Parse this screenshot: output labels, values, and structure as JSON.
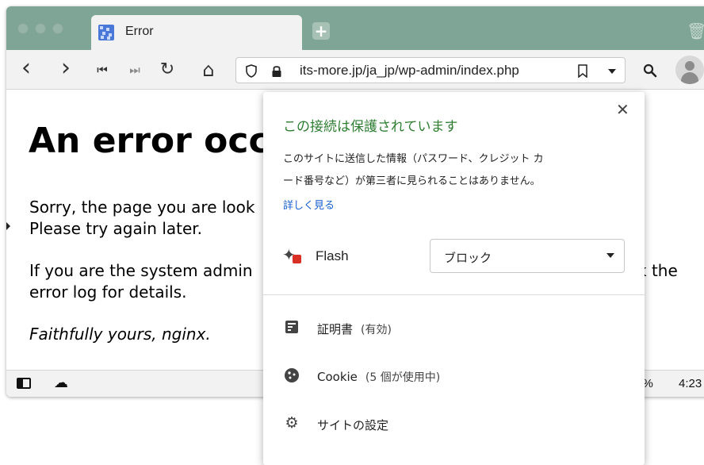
{
  "tab": {
    "title": "Error",
    "new_tab_symbol": "+"
  },
  "toolbar": {
    "back_icon": "‹",
    "forward_icon": "›",
    "first_icon": "⏮",
    "last_icon": "⏭",
    "reload_icon": "↻",
    "home_icon": "⌂",
    "search_icon": "🔍"
  },
  "urlbar": {
    "url": "its-more.jp/ja_jp/wp-admin/index.php",
    "shield_icon": "shield-icon",
    "lock_icon": "lock-icon",
    "bookmark_icon": "bookmark-icon",
    "dropdown_icon": "chevron-down-icon"
  },
  "page": {
    "heading": "An error occ",
    "p1_line1": "Sorry, the page you are look",
    "p1_line2": "Please try again later.",
    "p2_line1_left": "If you are the system admin",
    "p2_line1_right": "k the",
    "p2_line2": "error log for details.",
    "signature": "Faithfully yours, nginx."
  },
  "statusbar": {
    "zoom": "0 %",
    "time": "4:23"
  },
  "popup": {
    "close_label": "✕",
    "title": "この接続は保護されています",
    "desc_line1": "このサイトに送信した情報（パスワード、クレジット カ",
    "desc_line2": "ード番号など）が第三者に見られることはありません。",
    "link": "詳しく見る",
    "flash_label": "Flash",
    "flash_value": "ブロック",
    "items": [
      {
        "label": "証明書",
        "sub": "(有効)",
        "icon": "certificate-icon"
      },
      {
        "label": "Cookie",
        "sub": "(5 個が使用中)",
        "icon": "cookie-icon"
      },
      {
        "label": "サイトの設定",
        "sub": "",
        "icon": "gear-icon"
      }
    ]
  },
  "colors": {
    "tabbar": "#7fa596",
    "secure_green": "#2e7d32",
    "link_blue": "#1a5fd1",
    "flash_badge": "#d93025"
  }
}
